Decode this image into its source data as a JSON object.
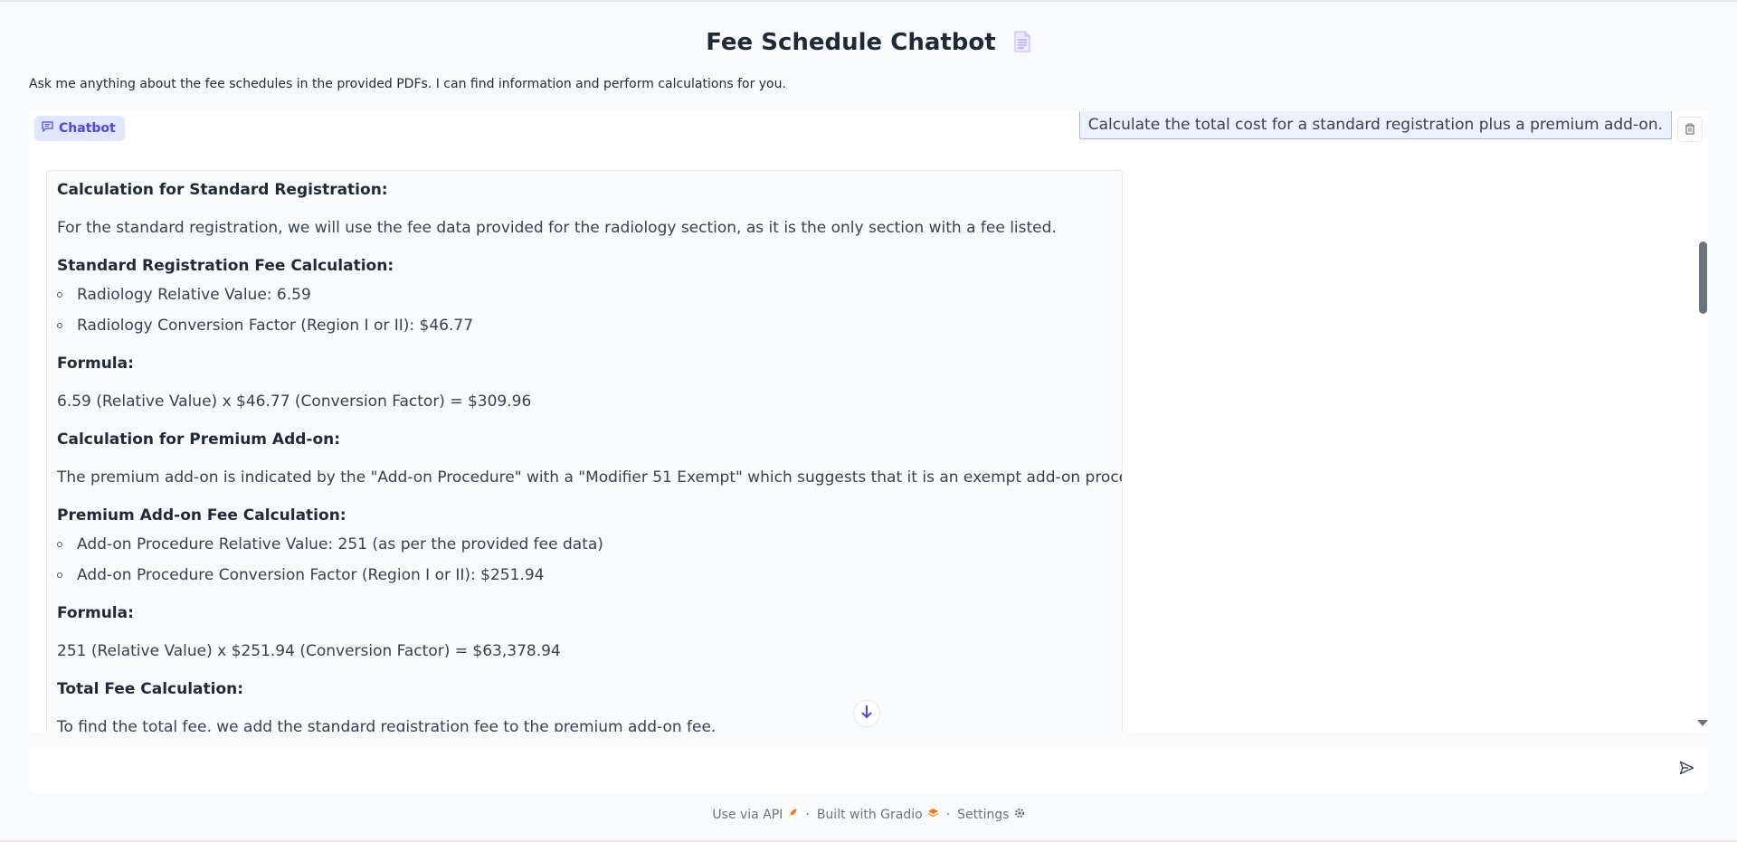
{
  "app": {
    "title": "Fee Schedule Chatbot",
    "title_icon": "document-icon",
    "description": "Ask me anything about the fee schedules in the provided PDFs. I can find information and perform calculations for you."
  },
  "chatbot": {
    "label": "Chatbot",
    "user_message": "Calculate the total cost for a standard registration plus a premium add-on.",
    "bot_message": {
      "h1": "Calculation for Standard Registration:",
      "p1": "For the standard registration, we will use the fee data provided for the radiology section, as it is the only section with a fee listed.",
      "h2": "Standard Registration Fee Calculation:",
      "li1": "Radiology Relative Value: 6.59",
      "li2": "Radiology Conversion Factor (Region I or II): $46.77",
      "h3": "Formula:",
      "p2": "6.59 (Relative Value) x $46.77 (Conversion Factor) = $309.96",
      "h4": "Calculation for Premium Add-on:",
      "p3": "The premium add-on is indicated by the \"Add-on Procedure\" with a \"Modifier 51 Exempt\" which suggests that it is an exempt add-on procedure.",
      "h5": "Premium Add-on Fee Calculation:",
      "li3": "Add-on Procedure Relative Value: 251 (as per the provided fee data)",
      "li4": "Add-on Procedure Conversion Factor (Region I or II): $251.94",
      "h6": "Formula:",
      "p4": "251 (Relative Value) x $251.94 (Conversion Factor) = $63,378.94",
      "h7": "Total Fee Calculation:",
      "p5": "To find the total fee, we add the standard registration fee to the premium add-on fee."
    }
  },
  "input": {
    "placeholder": "",
    "value": ""
  },
  "footer": {
    "api": "Use via API",
    "built": "Built with Gradio",
    "settings": "Settings",
    "separator": "·"
  },
  "colors": {
    "accent": "#4f46e5",
    "chip_bg": "#e0e7ff",
    "user_bubble_border": "#a5b4fc"
  }
}
